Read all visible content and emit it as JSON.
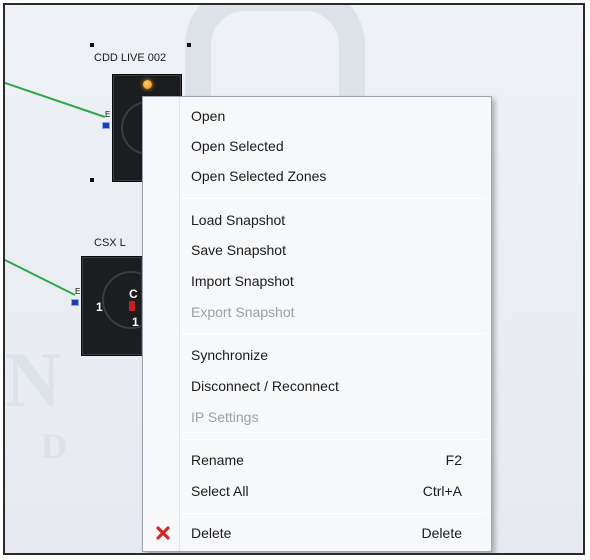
{
  "devices": [
    {
      "label": "CDD LIVE 002",
      "port_label": "E"
    },
    {
      "label": "CSX L",
      "port_label": "E",
      "port_number": "1",
      "glyph_top": "C",
      "glyph_bottom": "1"
    }
  ],
  "menu": {
    "items": [
      {
        "label": "Open",
        "enabled": true
      },
      {
        "label": "Open Selected",
        "enabled": true
      },
      {
        "label": "Open Selected Zones",
        "enabled": true
      },
      {
        "label": "Load Snapshot",
        "enabled": true
      },
      {
        "label": "Save Snapshot",
        "enabled": true
      },
      {
        "label": "Import Snapshot",
        "enabled": true
      },
      {
        "label": "Export Snapshot",
        "enabled": false
      },
      {
        "label": "Synchronize",
        "enabled": true
      },
      {
        "label": "Disconnect / Reconnect",
        "enabled": true
      },
      {
        "label": "IP Settings",
        "enabled": false
      },
      {
        "label": "Rename",
        "shortcut": "F2",
        "enabled": true
      },
      {
        "label": "Select All",
        "shortcut": "Ctrl+A",
        "enabled": true
      },
      {
        "label": "Delete",
        "shortcut": "Delete",
        "enabled": true,
        "icon": "delete-x-icon"
      }
    ]
  },
  "colors": {
    "wire": "#2fa74a",
    "delete_icon": "#d62828",
    "led": "#f08a00"
  }
}
